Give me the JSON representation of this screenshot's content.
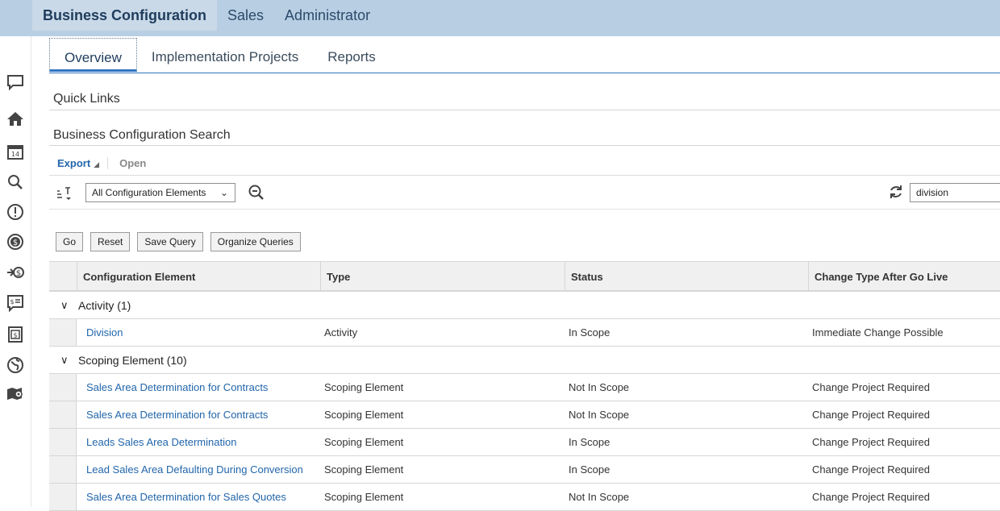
{
  "topnav": {
    "items": [
      "Business Configuration",
      "Sales",
      "Administrator"
    ]
  },
  "tabs": [
    "Overview",
    "Implementation Projects",
    "Reports"
  ],
  "sections": {
    "quick_links": "Quick Links",
    "search_title": "Business Configuration Search"
  },
  "toolbar": {
    "export_label": "Export",
    "open_label": "Open",
    "filter_select": "All Configuration Elements",
    "search_value": "division"
  },
  "query_buttons": {
    "go": "Go",
    "reset": "Reset",
    "save_query": "Save Query",
    "organize_queries": "Organize Queries"
  },
  "table": {
    "columns": [
      "Configuration Element",
      "Type",
      "Status",
      "Change Type After Go Live"
    ],
    "groups": [
      {
        "label": "Activity (1)",
        "rows": [
          [
            "Division",
            "Activity",
            "In Scope",
            "Immediate Change Possible"
          ]
        ]
      },
      {
        "label": "Scoping Element (10)",
        "rows": [
          [
            "Sales Area Determination for Contracts",
            "Scoping Element",
            "Not In Scope",
            "Change Project Required"
          ],
          [
            "Sales Area Determination for Contracts",
            "Scoping Element",
            "Not In Scope",
            "Change Project Required"
          ],
          [
            "Leads Sales Area Determination",
            "Scoping Element",
            "In Scope",
            "Change Project Required"
          ],
          [
            "Lead Sales Area Defaulting During Conversion",
            "Scoping Element",
            "In Scope",
            "Change Project Required"
          ],
          [
            "Sales Area Determination for Sales Quotes",
            "Scoping Element",
            "Not In Scope",
            "Change Project Required"
          ]
        ]
      }
    ]
  },
  "left_rail_icons": [
    "feedback-icon",
    "home-icon",
    "calendar-icon",
    "search-icon",
    "alert-icon",
    "money-icon",
    "transfer-money-icon",
    "price-list-icon",
    "invoice-icon",
    "global-icon",
    "map-icon"
  ],
  "colors": {
    "topbar": "#b8cfe3",
    "link": "#2266aa",
    "tab_underline": "#2f74c0"
  }
}
